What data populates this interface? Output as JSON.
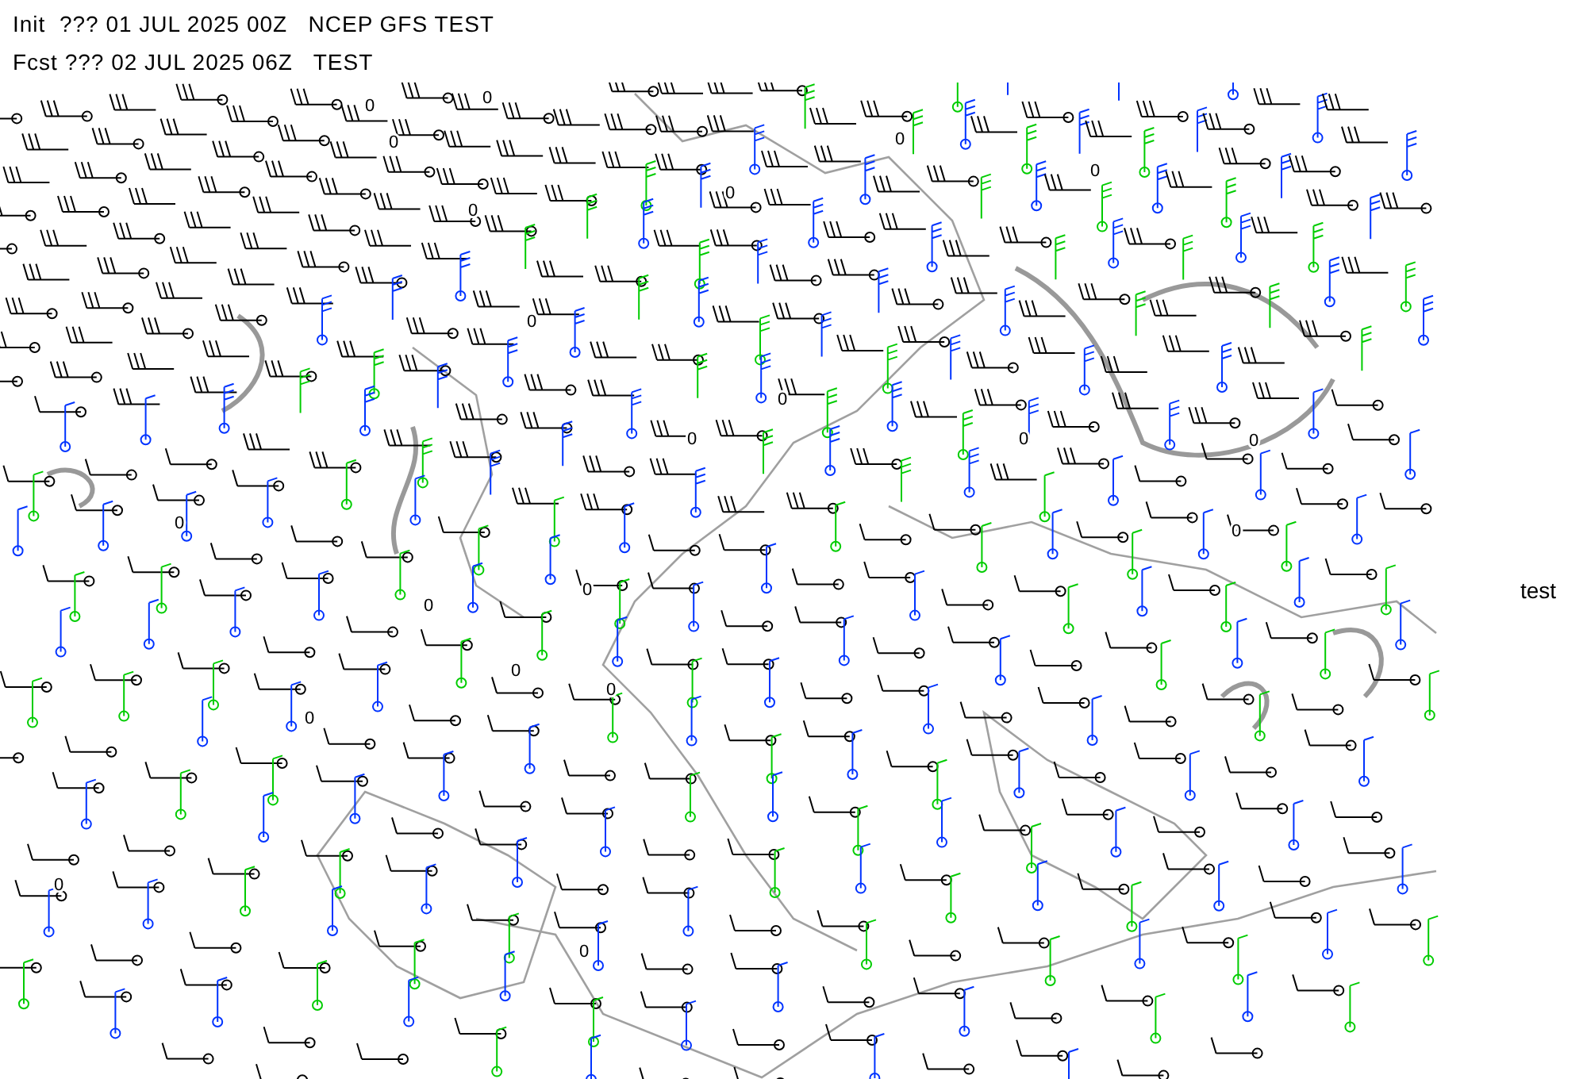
{
  "header": {
    "init_line": "Init  ??? 01 JUL 2025 00Z   NCEP GFS TEST",
    "forecast_line": "Fcst ??? 02 JUL 2025 06Z   TEST"
  },
  "map": {
    "contour_labels": [
      "0",
      "0",
      "0",
      "0",
      "0",
      "0",
      "0",
      "0",
      "0",
      "0",
      "0",
      "0",
      "0",
      "0",
      "0",
      "0",
      "0",
      "0",
      "0",
      "0",
      "0"
    ]
  },
  "side_label": "test"
}
